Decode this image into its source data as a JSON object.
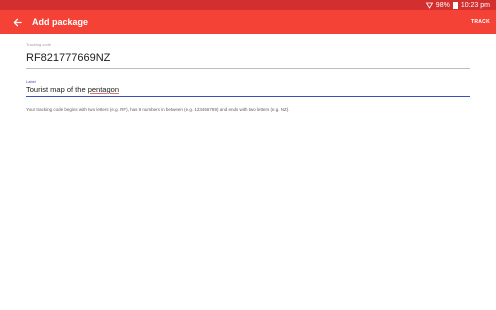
{
  "status_bar": {
    "battery_percent": "98%",
    "time": "10:23 pm"
  },
  "app_bar": {
    "title": "Add package",
    "action_label": "TRACK",
    "background": "#f44336"
  },
  "tracking_code": {
    "label": "Tracking code",
    "value": "RF821777669NZ"
  },
  "label_field": {
    "caption": "Label",
    "value_prefix": "Tourist map of the ",
    "value_underlined": "pentagon"
  },
  "hint": "Your tracking code begins with two letters (e.g. RF), has 9 numbers in between (e.g. 123456789) and ends with two letters (e.g. NZ)."
}
